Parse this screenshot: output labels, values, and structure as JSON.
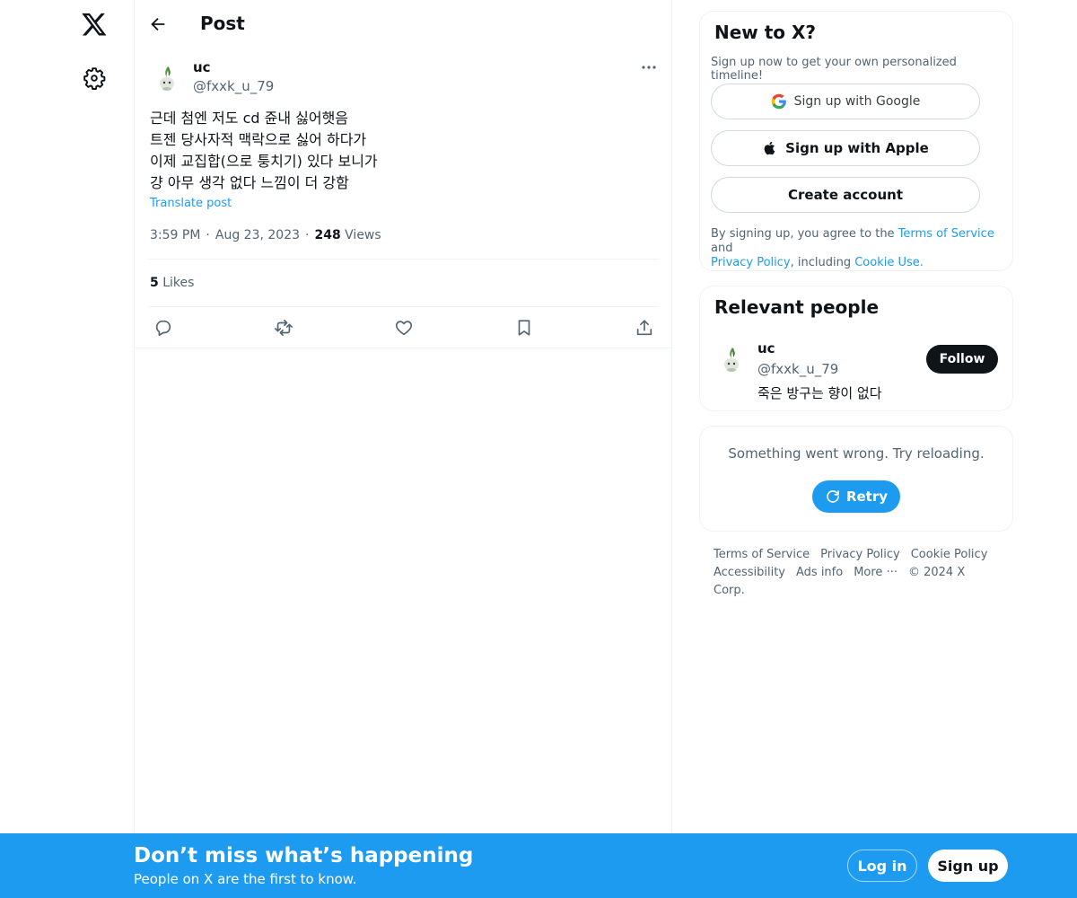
{
  "header": {
    "title": "Post"
  },
  "post": {
    "author_name": "uc",
    "author_handle": "@fxxk_u_79",
    "text": "근데 첨엔 저도 cd 쥰내 싫어햇음\n트젠 당사자적 맥락으로 싫어 하다가\n이제 교집합(으로 퉁치기) 있다 보니가\n걍 아무 생각 없다 느낌이 더 강함",
    "translate_label": "Translate post",
    "time": "3:59 PM",
    "date": "Aug 23, 2023",
    "views_count": "248",
    "views_label": "Views",
    "likes_count": "5",
    "likes_label": "Likes"
  },
  "signup_card": {
    "title": "New to X?",
    "subtitle": "Sign up now to get your own personalized timeline!",
    "google_label": "Sign up with Google",
    "apple_label": "Sign up with Apple",
    "create_label": "Create account",
    "legal_prefix": "By signing up, you agree to the ",
    "terms_link": "Terms of Service",
    "legal_and": " and",
    "privacy_link": "Privacy Policy",
    "legal_including": ", including ",
    "cookie_link": "Cookie Use."
  },
  "relevant": {
    "title": "Relevant people",
    "name": "uc",
    "handle": "@fxxk_u_79",
    "bio": "죽은 방구는 향이 없다",
    "follow_label": "Follow"
  },
  "error_card": {
    "message": "Something went wrong. Try reloading.",
    "retry_label": "Retry"
  },
  "footer": {
    "terms": "Terms of Service",
    "privacy": "Privacy Policy",
    "cookie": "Cookie Policy",
    "accessibility": "Accessibility",
    "ads": "Ads info",
    "more": "More ···",
    "copyright": "© 2024 X Corp."
  },
  "banner": {
    "title": "Don’t miss what’s happening",
    "subtitle": "People on X are the first to know.",
    "login_label": "Log in",
    "signup_label": "Sign up"
  },
  "colors": {
    "accent": "#1d9bf0",
    "text": "#0f1419",
    "muted": "#536471"
  },
  "icons": [
    "x-logo-icon",
    "gear-icon",
    "back-arrow-icon",
    "more-dots-icon",
    "reply-icon",
    "repost-icon",
    "like-icon",
    "bookmark-icon",
    "share-icon",
    "google-icon",
    "apple-icon",
    "refresh-icon"
  ]
}
